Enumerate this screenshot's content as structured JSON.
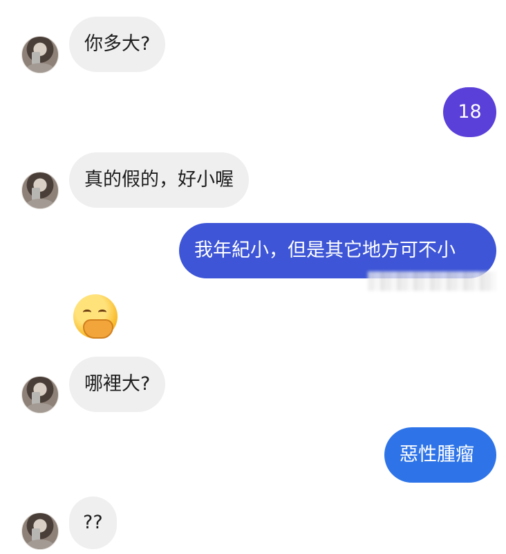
{
  "messages": [
    {
      "side": "in",
      "text": "你多大?"
    },
    {
      "side": "out",
      "text": "18",
      "color": "#5b3fd9"
    },
    {
      "side": "in",
      "text": "真的假的，好小喔"
    },
    {
      "side": "out",
      "text": "我年紀小，但是其它地方可不小",
      "color": "#3d55d6"
    },
    {
      "side": "in",
      "emoji": "hand-over-mouth-emoji"
    },
    {
      "side": "in",
      "text": "哪裡大?"
    },
    {
      "side": "out",
      "text": "惡性腫瘤",
      "color": "#2e74e8"
    },
    {
      "side": "in",
      "text": "??"
    }
  ],
  "colors": {
    "incoming_bubble": "#efefef",
    "incoming_text": "#1d1d1d",
    "outgoing_text": "#ffffff"
  }
}
